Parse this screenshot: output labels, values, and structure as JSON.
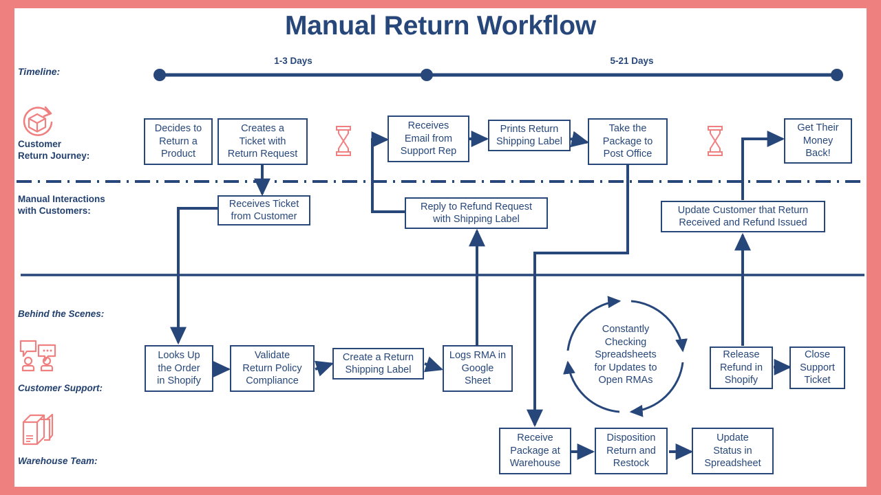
{
  "title": "Manual Return Workflow",
  "colors": {
    "frame": "#ee8080",
    "accent": "#f08080",
    "navy": "#27477a",
    "background": "#ffffff"
  },
  "timeline": {
    "label": "Timeline:",
    "segments": [
      {
        "label": "1-3 Days"
      },
      {
        "label": "5-21 Days"
      }
    ]
  },
  "lanes": [
    {
      "id": "customer-return-journey",
      "label": "Customer\nReturn Journey:",
      "icon": "return-package-icon"
    },
    {
      "id": "manual-interactions",
      "label": "Manual Interactions\nwith Customers:",
      "icon": null
    },
    {
      "id": "behind-the-scenes",
      "label": "Behind the Scenes:",
      "icon": null
    },
    {
      "id": "customer-support",
      "label": "Customer Support:",
      "icon": "chat-people-icon"
    },
    {
      "id": "warehouse-team",
      "label": "Warehouse Team:",
      "icon": "boxes-icon"
    }
  ],
  "lane_labels": {
    "customer_return_journey_line1": "Customer",
    "customer_return_journey_line2": "Return Journey:",
    "manual_interactions_line1": "Manual Interactions",
    "manual_interactions_line2": "with Customers:",
    "behind_the_scenes": "Behind the Scenes:",
    "customer_support": "Customer Support:",
    "warehouse_team": "Warehouse Team:"
  },
  "nodes": {
    "decides_to_return": "Decides to\nReturn a\nProduct",
    "creates_ticket": "Creates a\nTicket with\nReturn Request",
    "receives_email": "Receives\nEmail from\nSupport Rep",
    "prints_label": "Prints Return\nShipping Label",
    "take_package": "Take the\nPackage to\nPost Office",
    "get_money_back": "Get Their\nMoney\nBack!",
    "receives_ticket": "Receives Ticket\nfrom Customer",
    "reply_refund": "Reply to Refund Request\nwith Shipping Label",
    "update_customer": "Update Customer that Return\nReceived and Refund Issued",
    "looks_up_order": "Looks Up\nthe Order\nin Shopify",
    "validate_policy": "Validate\nReturn Policy\nCompliance",
    "create_label": "Create a Return\nShipping Label",
    "logs_rma": "Logs RMA in\nGoogle\nSheet",
    "constantly_checking": "Constantly\nChecking\nSpreadsheets\nfor Updates to\nOpen RMAs",
    "release_refund": "Release\nRefund in\nShopify",
    "close_ticket": "Close\nSupport\nTicket",
    "receive_package": "Receive\nPackage at\nWarehouse",
    "disposition_return": "Disposition\nReturn and\nRestock",
    "update_status": "Update\nStatus in\nSpreadsheet"
  },
  "icons": {
    "hourglass_1": "hourglass-icon",
    "hourglass_2": "hourglass-icon"
  }
}
